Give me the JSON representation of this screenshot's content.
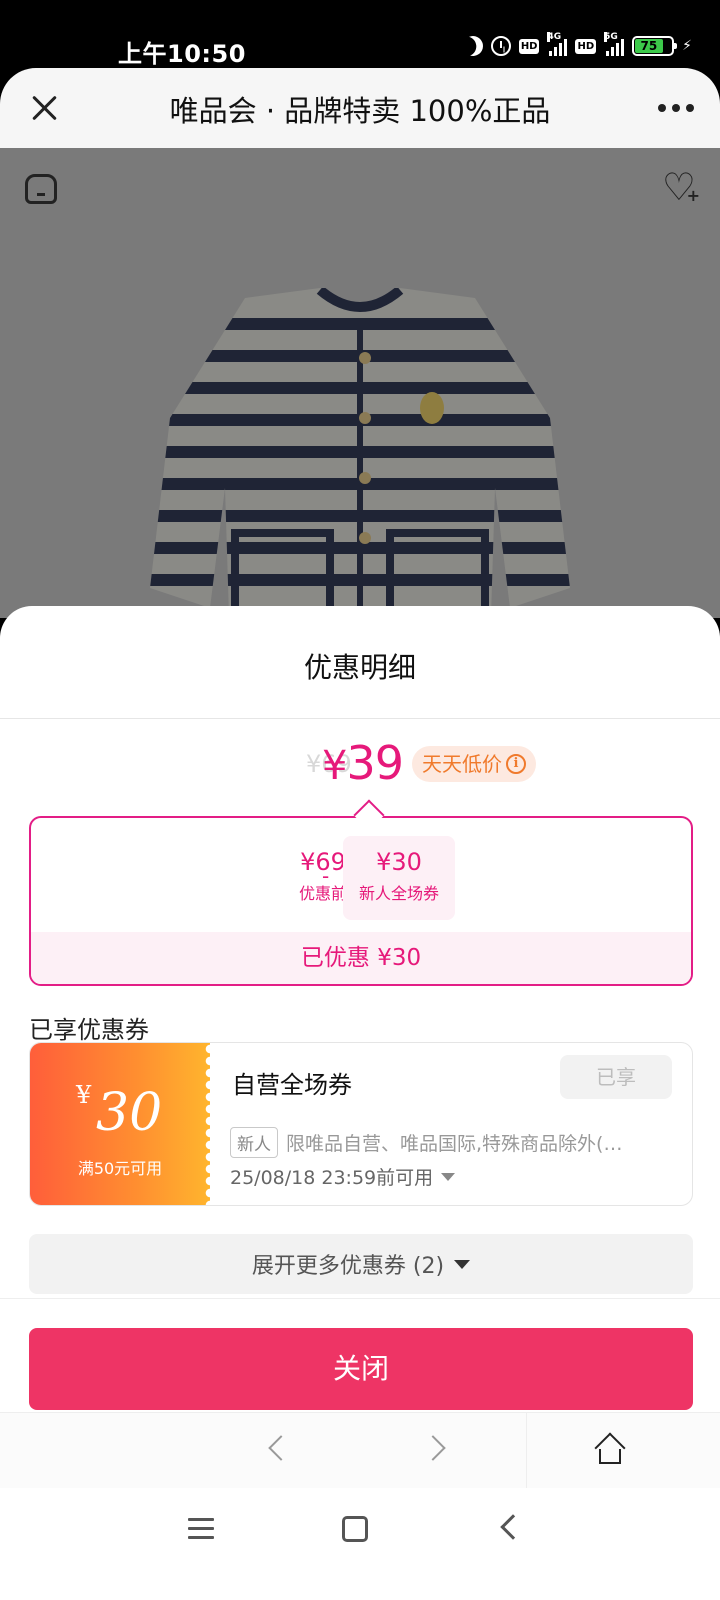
{
  "status_bar": {
    "time": "上午10:50",
    "network_1": "4G",
    "network_2": "5G",
    "hd_1": "HD",
    "hd_2": "HD",
    "battery": "75"
  },
  "header": {
    "title": "唯品会 · 品牌特卖 100%正品"
  },
  "sheet": {
    "title": "优惠明细",
    "ghost_price": "¥69",
    "final_price_symbol": "¥",
    "final_price_value": "39",
    "daily_low_tag": "天天低价",
    "calc": {
      "before_value": "¥69",
      "before_label": "优惠前",
      "minus": "-",
      "coupon_value": "¥30",
      "coupon_label": "新人全场券",
      "saved": "已优惠 ¥30"
    },
    "section_title": "已享优惠券",
    "coupon": {
      "symbol": "¥",
      "amount": "30",
      "condition": "满50元可用",
      "name": "自营全场券",
      "status": "已享",
      "tag": "新人",
      "description": "限唯品自营、唯品国际,特殊商品除外(…",
      "expiry": "25/08/18 23:59前可用"
    },
    "expand_label": "展开更多优惠券 (2)",
    "close_label": "关闭"
  },
  "colors": {
    "accent": "#e6197a",
    "close_button": "#ee3465",
    "coupon_gradient_start": "#ff5e3a",
    "coupon_gradient_end": "#ffb52e",
    "daily_tag": "#f07a2c"
  }
}
